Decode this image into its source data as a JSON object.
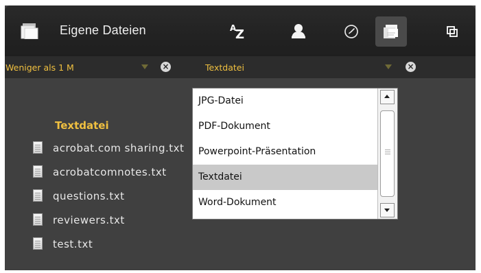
{
  "toolbar": {
    "folder_title": "Eigene Dateien",
    "sort_az_label_a": "A",
    "sort_az_label_z": "Z",
    "icons": {
      "folder": "folder-stack-icon",
      "sort": "sort-az-icon",
      "users": "people-icon",
      "recent": "clock-icon",
      "filter_active": "file-filter-icon",
      "view": "view-toggle-icon"
    }
  },
  "filters": {
    "size": {
      "label": "Weniger als 1 M",
      "clear_icon": "×"
    },
    "type": {
      "label": "Textdatei",
      "clear_icon": "×"
    }
  },
  "dropdown": {
    "items": [
      "JPG-Datei",
      "PDF-Dokument",
      "Powerpoint-Präsentation",
      "Textdatei",
      "Word-Dokument"
    ],
    "selected": "Textdatei"
  },
  "group": {
    "header": "Textdatei"
  },
  "files": [
    "acrobat.com sharing.txt",
    "acrobatcomnotes.txt",
    "questions.txt",
    "reviewers.txt",
    "test.txt"
  ],
  "colors": {
    "accent": "#f0c040",
    "window_bg": "#404040",
    "toolbar_bg": "#222222",
    "dropdown_bg": "#ffffff",
    "dropdown_selected": "#c9c9c9"
  }
}
